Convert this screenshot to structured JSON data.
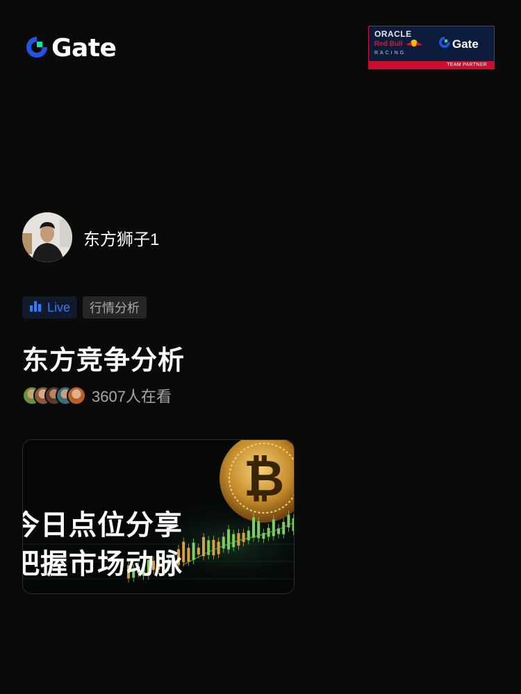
{
  "header": {
    "logo_text": "Gate",
    "partner": {
      "oracle": "ORACLE",
      "redbull": "Red Bull",
      "racing": "RACING",
      "gate": "Gate",
      "badge": "TEAM PARTNER"
    }
  },
  "host": {
    "name": "东方狮子1"
  },
  "tags": {
    "live": "Live",
    "category": "行情分析"
  },
  "stream": {
    "title": "东方竞争分析",
    "viewers": "3607人在看"
  },
  "cover": {
    "line1": "今日点位分享",
    "line2": "把握市场动脉"
  },
  "colors": {
    "background": "#0a0a0a",
    "accent": "#2f7bff",
    "gate_green": "#17e5a3",
    "gate_blue": "#2354e6"
  }
}
